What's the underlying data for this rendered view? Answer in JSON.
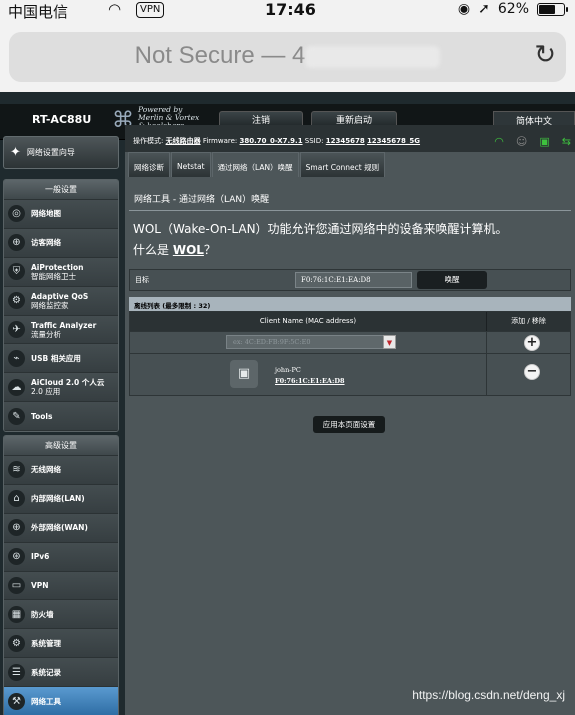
{
  "statusbar": {
    "carrier": "中国电信",
    "vpn": "VPN",
    "time": "17:46",
    "battery": "62%",
    "battery_level": 0.62
  },
  "browser": {
    "url_prefix": "Not Secure — 4"
  },
  "header": {
    "model": "RT-AC88U",
    "powered_line1": "Powered by",
    "powered_line2": "Merlin & Vortex",
    "powered_line3": "& koolshare",
    "logout": "注销",
    "reboot": "重新启动",
    "language": "简体中文"
  },
  "opbar": {
    "mode_label": "操作模式:",
    "mode_value": "无线路由器",
    "fw_label": "Firmware:",
    "fw_value": "380.70_0-X7.9.1",
    "ssid_label": "SSID:",
    "ssid_1": "12345678",
    "ssid_2": "12345678_5G"
  },
  "sidebar": {
    "quick_setup": "网络设置向导",
    "general_title": "一般设置",
    "general_items": [
      {
        "l1": "网络地图",
        "l2": "",
        "icon": "map-icon",
        "glyph": "◎"
      },
      {
        "l1": "访客网络",
        "l2": "",
        "icon": "globe-icon",
        "glyph": "⊕"
      },
      {
        "l1": "AiProtection",
        "l2": "智能网络卫士",
        "icon": "shield-icon",
        "glyph": "⛨"
      },
      {
        "l1": "Adaptive QoS",
        "l2": "网络监控家",
        "icon": "qos-icon",
        "glyph": "⚙"
      },
      {
        "l1": "Traffic Analyzer",
        "l2": "流量分析",
        "icon": "traffic-icon",
        "glyph": "✈"
      },
      {
        "l1": "USB 相关应用",
        "l2": "",
        "icon": "usb-icon",
        "glyph": "⌁"
      },
      {
        "l1": "AiCloud 2.0 个人云",
        "l2": "2.0 应用",
        "icon": "cloud-icon",
        "glyph": "☁"
      },
      {
        "l1": "Tools",
        "l2": "",
        "icon": "wrench-icon",
        "glyph": "✎"
      }
    ],
    "advanced_title": "高级设置",
    "advanced_items": [
      {
        "l1": "无线网络",
        "icon": "wireless-icon",
        "glyph": "≋"
      },
      {
        "l1": "内部网络(LAN)",
        "icon": "lan-icon",
        "glyph": "⌂"
      },
      {
        "l1": "外部网络(WAN)",
        "icon": "wan-icon",
        "glyph": "⊕"
      },
      {
        "l1": "IPv6",
        "icon": "ipv6-icon",
        "glyph": "⊛"
      },
      {
        "l1": "VPN",
        "icon": "vpn-icon",
        "glyph": "▭"
      },
      {
        "l1": "防火墙",
        "icon": "firewall-icon",
        "glyph": "▦"
      },
      {
        "l1": "系统管理",
        "icon": "admin-icon",
        "glyph": "⚙"
      },
      {
        "l1": "系统记录",
        "icon": "log-icon",
        "glyph": "☰"
      },
      {
        "l1": "网络工具",
        "icon": "tools-icon",
        "glyph": "⚒"
      }
    ]
  },
  "tabs": [
    "网络诊断",
    "Netstat",
    "通过网络（LAN）唤醒",
    "Smart Connect 规则"
  ],
  "content": {
    "title": "网络工具 - 通过网络（LAN）唤醒",
    "description": "WOL（Wake-On-LAN）功能允许您通过网络中的设备来唤醒计算机。",
    "whatis_prefix": "什么是 ",
    "whatis_link": "WOL",
    "whatis_suffix": "？",
    "target_label": "目标",
    "target_value": "F0:76:1C:E1:EA:D8",
    "wake_button": "唤醒",
    "list_title": "离线列表 (最多限制 : 32)",
    "col_client": "Client Name (MAC address)",
    "col_action": "添加 / 移除",
    "select_placeholder": "ex: 4C:ED:FB:9F:5C:E0",
    "client_name": "john-PC",
    "client_mac": "F0:76:1C:E1:EA:D8",
    "apply_button": "应用本页面设置"
  },
  "watermark": "https://blog.csdn.net/deng_xj"
}
